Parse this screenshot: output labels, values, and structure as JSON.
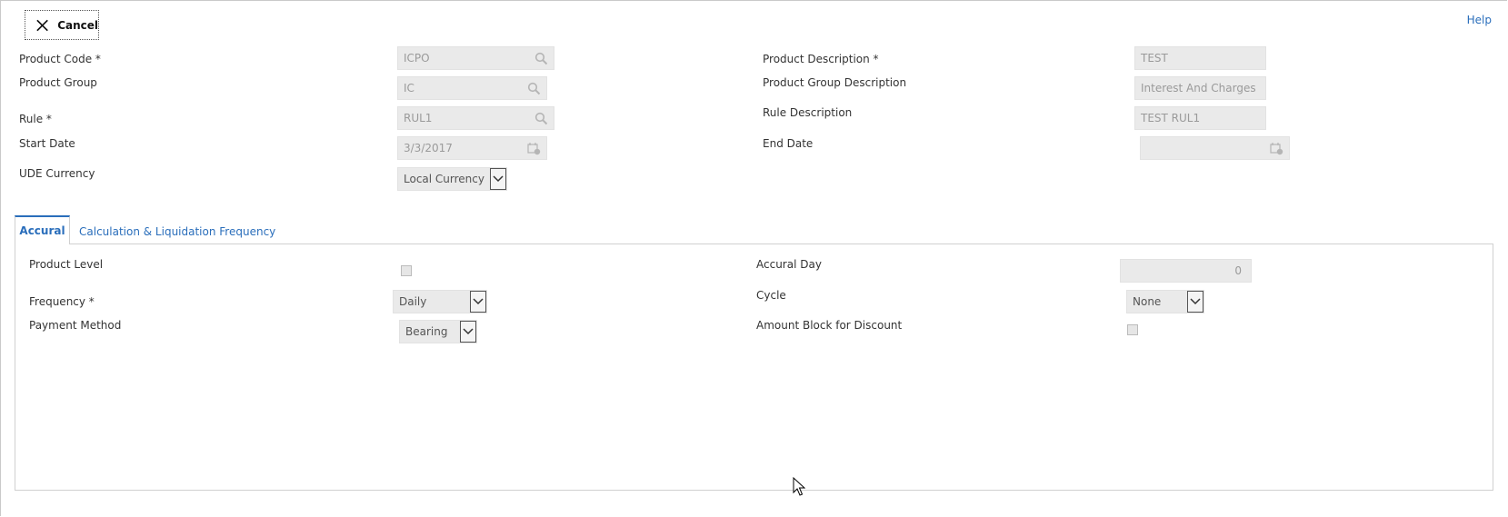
{
  "toolbar": {
    "cancel_label": "Cancel",
    "help_label": "Help"
  },
  "form": {
    "product_code": {
      "label": "Product Code *",
      "value": "ICPO"
    },
    "product_description": {
      "label": "Product Description *",
      "value": "TEST"
    },
    "product_group": {
      "label": "Product Group",
      "value": "IC"
    },
    "product_group_description": {
      "label": "Product Group Description",
      "value": "Interest And Charges"
    },
    "rule": {
      "label": "Rule *",
      "value": "RUL1"
    },
    "rule_description": {
      "label": "Rule Description",
      "value": "TEST RUL1"
    },
    "start_date": {
      "label": "Start Date",
      "value": "3/3/2017"
    },
    "end_date": {
      "label": "End Date",
      "value": ""
    },
    "ude_currency": {
      "label": "UDE Currency",
      "value": "Local Currency"
    }
  },
  "tabs": [
    {
      "label": "Accural",
      "active": true
    },
    {
      "label": "Calculation & Liquidation Frequency",
      "active": false
    }
  ],
  "accural": {
    "product_level": {
      "label": "Product Level",
      "checked": false
    },
    "accural_day": {
      "label": "Accural Day",
      "value": "0"
    },
    "frequency": {
      "label": "Frequency *",
      "value": "Daily"
    },
    "cycle": {
      "label": "Cycle",
      "value": "None"
    },
    "payment_method": {
      "label": "Payment Method",
      "value": "Bearing"
    },
    "amount_block": {
      "label": "Amount Block for Discount",
      "checked": false
    }
  },
  "colors": {
    "accent": "#2a6ebb",
    "field_bg": "#eaeaea"
  },
  "icons": [
    "close-icon",
    "search-icon",
    "calendar-icon",
    "chevron-down-icon",
    "mouse-cursor-icon"
  ]
}
